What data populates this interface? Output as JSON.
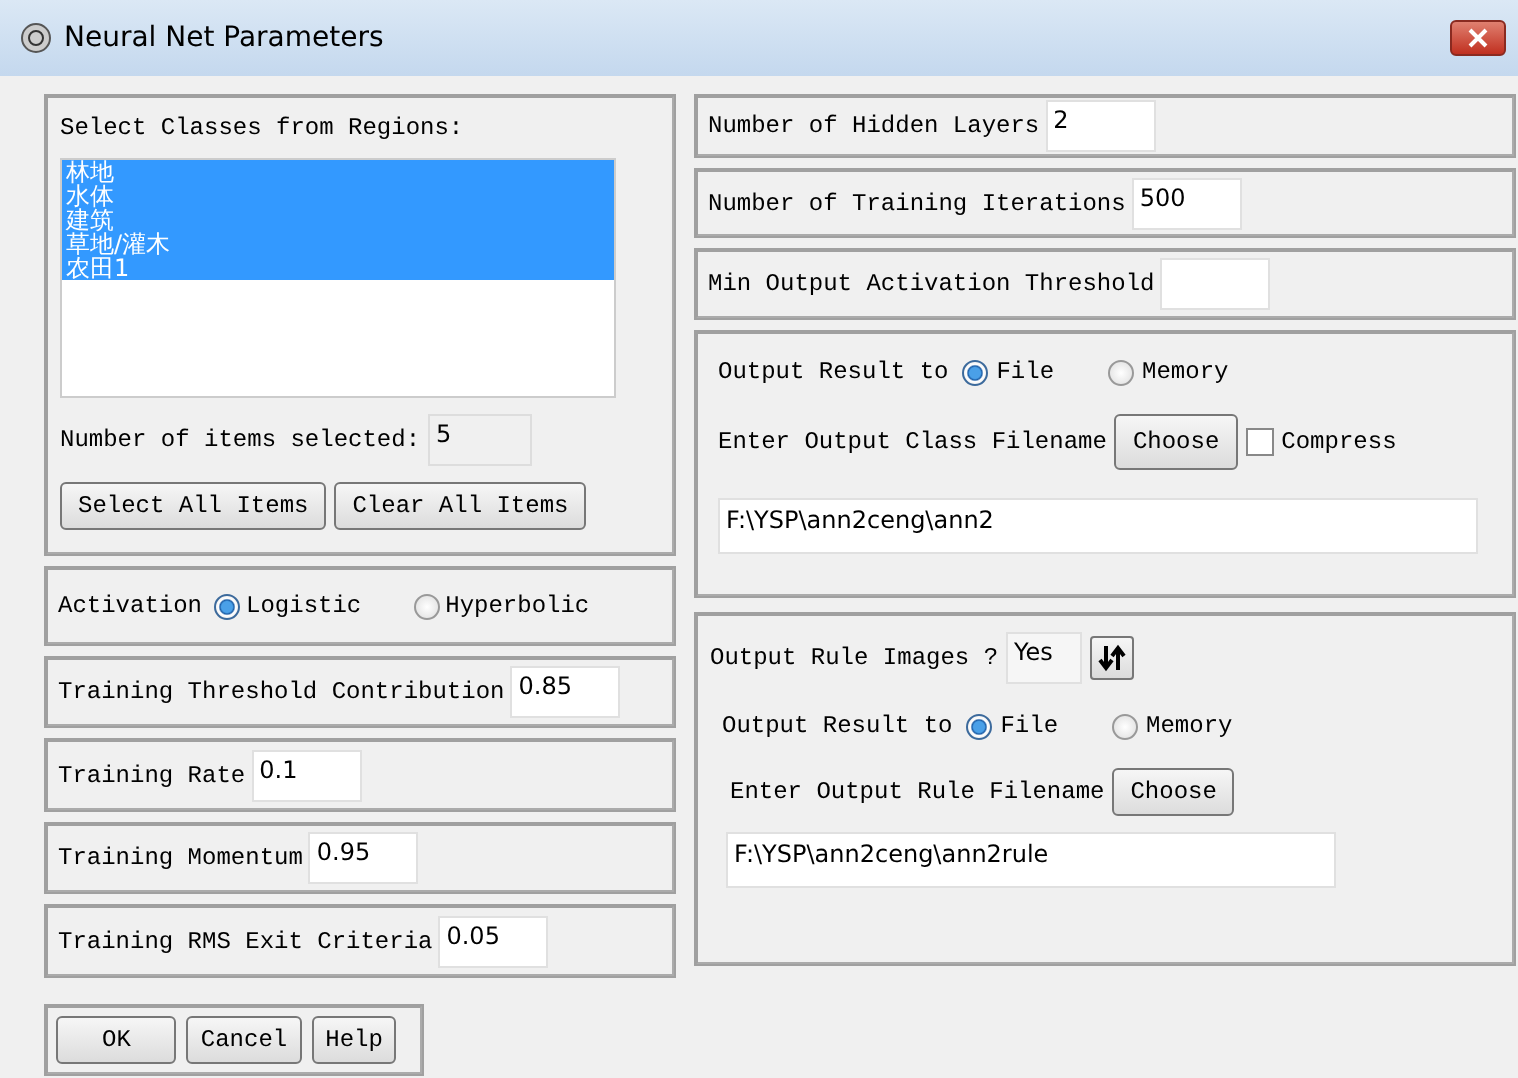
{
  "window": {
    "title": "Neural Net Parameters"
  },
  "classes": {
    "label": "Select Classes from Regions:",
    "items": [
      {
        "label": "林地",
        "selected": true
      },
      {
        "label": "水体",
        "selected": true
      },
      {
        "label": "建筑",
        "selected": true
      },
      {
        "label": "草地/灌木",
        "selected": true
      },
      {
        "label": "农田1",
        "selected": true
      }
    ],
    "count_label": "Number of items selected:",
    "count": "5",
    "buttons": [
      "Select All Items",
      "Clear All Items"
    ]
  },
  "activation": {
    "label": "Activation",
    "options": [
      {
        "label": "Logistic",
        "selected": true
      },
      {
        "label": "Hyperbolic",
        "selected": false
      }
    ]
  },
  "left_fields": [
    {
      "label": "Training Threshold Contribution",
      "value": "0.85"
    },
    {
      "label": "Training Rate",
      "value": "0.1"
    },
    {
      "label": "Training Momentum",
      "value": "0.95"
    },
    {
      "label": "Training RMS Exit Criteria",
      "value": "0.05"
    }
  ],
  "right_fields": [
    {
      "label": "Number of Hidden Layers",
      "value": "2"
    },
    {
      "label": "Number of Training Iterations",
      "value": "500"
    },
    {
      "label": "Min Output Activation Threshold"
    }
  ],
  "class_output": {
    "label": "Output Result to",
    "options": [
      {
        "label": "File",
        "selected": true
      },
      {
        "label": "Memory",
        "selected": false
      }
    ],
    "filename_label": "Enter Output Class Filename",
    "choose": "Choose",
    "compress": {
      "label": "Compress",
      "checked": false
    },
    "path": "F:\\YSP\\ann2ceng\\ann2"
  },
  "rule_output": {
    "label": "Output Rule Images ?",
    "toggle": "Yes",
    "output_label": "Output Result to",
    "options": [
      {
        "label": "File",
        "selected": true
      },
      {
        "label": "Memory",
        "selected": false
      }
    ],
    "filename_label": "Enter Output Rule Filename",
    "choose": "Choose",
    "path": "F:\\YSP\\ann2ceng\\ann2rule"
  },
  "buttons": [
    "OK",
    "Cancel",
    "Help"
  ]
}
